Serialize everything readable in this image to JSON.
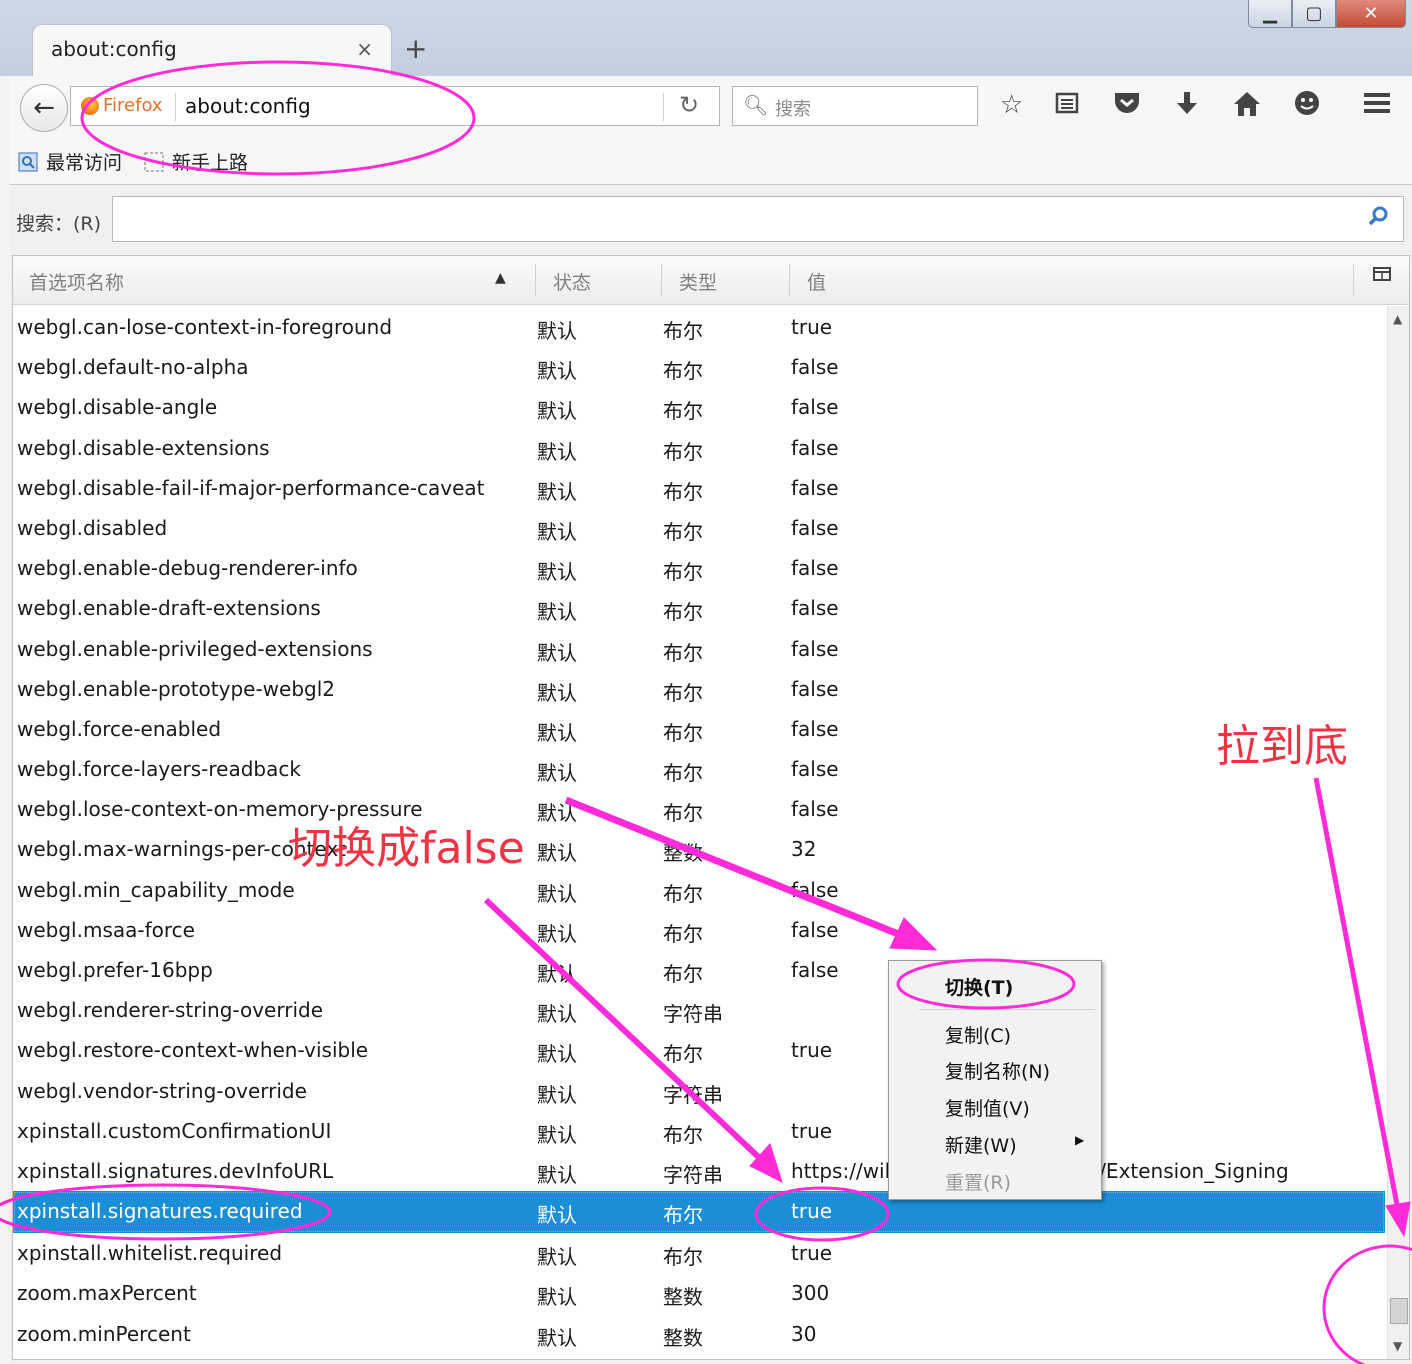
{
  "window": {
    "controls": [
      "▁",
      "▢",
      "✕"
    ]
  },
  "tab": {
    "title": "about:config",
    "close": "×",
    "new_tab": "+"
  },
  "toolbar": {
    "back": "←",
    "identity_label": "Firefox",
    "url": "about:config",
    "reload": "↻",
    "search_placeholder": "搜索",
    "icons": [
      "star-icon",
      "reading-list-icon",
      "pocket-icon",
      "download-icon",
      "home-icon",
      "hello-icon",
      "menu-icon"
    ]
  },
  "bookmarks": [
    {
      "label": "最常访问",
      "icon": "most-visited-icon"
    },
    {
      "label": "新手上路",
      "icon": "getting-started-icon"
    }
  ],
  "filter": {
    "label": "搜索：(R)",
    "value": ""
  },
  "table": {
    "headers": {
      "name": "首选项名称",
      "status": "状态",
      "type": "类型",
      "value": "值"
    },
    "sorted_by": "name",
    "rows": [
      {
        "name": "webgl.can-lose-context-in-foreground",
        "status": "默认",
        "type": "布尔",
        "value": "true"
      },
      {
        "name": "webgl.default-no-alpha",
        "status": "默认",
        "type": "布尔",
        "value": "false"
      },
      {
        "name": "webgl.disable-angle",
        "status": "默认",
        "type": "布尔",
        "value": "false"
      },
      {
        "name": "webgl.disable-extensions",
        "status": "默认",
        "type": "布尔",
        "value": "false"
      },
      {
        "name": "webgl.disable-fail-if-major-performance-caveat",
        "status": "默认",
        "type": "布尔",
        "value": "false"
      },
      {
        "name": "webgl.disabled",
        "status": "默认",
        "type": "布尔",
        "value": "false"
      },
      {
        "name": "webgl.enable-debug-renderer-info",
        "status": "默认",
        "type": "布尔",
        "value": "false"
      },
      {
        "name": "webgl.enable-draft-extensions",
        "status": "默认",
        "type": "布尔",
        "value": "false"
      },
      {
        "name": "webgl.enable-privileged-extensions",
        "status": "默认",
        "type": "布尔",
        "value": "false"
      },
      {
        "name": "webgl.enable-prototype-webgl2",
        "status": "默认",
        "type": "布尔",
        "value": "false"
      },
      {
        "name": "webgl.force-enabled",
        "status": "默认",
        "type": "布尔",
        "value": "false"
      },
      {
        "name": "webgl.force-layers-readback",
        "status": "默认",
        "type": "布尔",
        "value": "false"
      },
      {
        "name": "webgl.lose-context-on-memory-pressure",
        "status": "默认",
        "type": "布尔",
        "value": "false"
      },
      {
        "name": "webgl.max-warnings-per-context",
        "status": "默认",
        "type": "整数",
        "value": "32"
      },
      {
        "name": "webgl.min_capability_mode",
        "status": "默认",
        "type": "布尔",
        "value": "false"
      },
      {
        "name": "webgl.msaa-force",
        "status": "默认",
        "type": "布尔",
        "value": "false"
      },
      {
        "name": "webgl.prefer-16bpp",
        "status": "默认",
        "type": "布尔",
        "value": "false"
      },
      {
        "name": "webgl.renderer-string-override",
        "status": "默认",
        "type": "字符串",
        "value": ""
      },
      {
        "name": "webgl.restore-context-when-visible",
        "status": "默认",
        "type": "布尔",
        "value": "true"
      },
      {
        "name": "webgl.vendor-string-override",
        "status": "默认",
        "type": "字符串",
        "value": ""
      },
      {
        "name": "xpinstall.customConfirmationUI",
        "status": "默认",
        "type": "布尔",
        "value": "true"
      },
      {
        "name": "xpinstall.signatures.devInfoURL",
        "status": "默认",
        "type": "字符串",
        "value": "https://wiki.mozilla.org/Addons/Extension_Signing"
      },
      {
        "name": "xpinstall.signatures.required",
        "status": "默认",
        "type": "布尔",
        "value": "true",
        "selected": true
      },
      {
        "name": "xpinstall.whitelist.required",
        "status": "默认",
        "type": "布尔",
        "value": "true"
      },
      {
        "name": "zoom.maxPercent",
        "status": "默认",
        "type": "整数",
        "value": "300"
      },
      {
        "name": "zoom.minPercent",
        "status": "默认",
        "type": "整数",
        "value": "30"
      }
    ]
  },
  "context_menu": {
    "items": [
      {
        "label": "切换(T)",
        "default": true
      },
      {
        "label": "复制(C)"
      },
      {
        "label": "复制名称(N)"
      },
      {
        "label": "复制值(V)"
      },
      {
        "label": "新建(W)",
        "submenu": true
      },
      {
        "label": "重置(R)",
        "disabled": true
      }
    ]
  },
  "annotations": {
    "toggle_note": "切换成false",
    "scroll_note": "拉到底",
    "color": "#ff2bd8",
    "text_color": "#ee3344"
  },
  "colors": {
    "selection": "#1a8fd6",
    "firefox_orange": "#e87020"
  }
}
